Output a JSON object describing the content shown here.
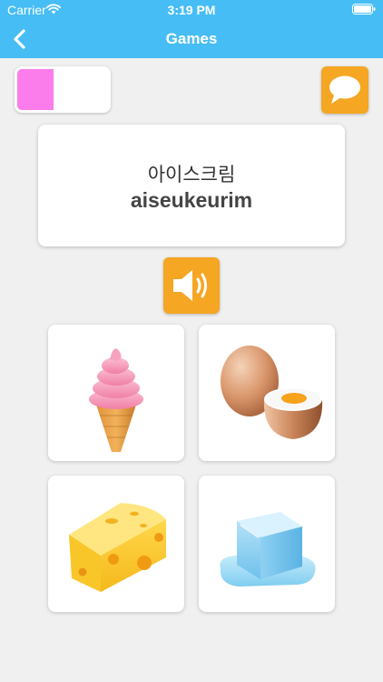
{
  "status_bar": {
    "carrier": "Carrier",
    "time": "3:19 PM",
    "wifi_icon": "wifi-icon",
    "battery_icon": "battery-icon"
  },
  "nav": {
    "title": "Games",
    "back_icon": "chevron-left-icon"
  },
  "progress": {
    "fraction": 0.4,
    "color": "#fb7ceb"
  },
  "word": {
    "korean": "아이스크림",
    "romanization": "aiseukeurim"
  },
  "buttons": {
    "chat_icon": "speech-bubble-icon",
    "sound_icon": "speaker-icon",
    "accent_color": "#f5a623"
  },
  "choices": [
    {
      "icon": "ice-cream-icon"
    },
    {
      "icon": "egg-icon"
    },
    {
      "icon": "cheese-icon"
    },
    {
      "icon": "ice-cube-icon"
    }
  ],
  "colors": {
    "header": "#46bdf4",
    "background": "#f0f0f0"
  }
}
